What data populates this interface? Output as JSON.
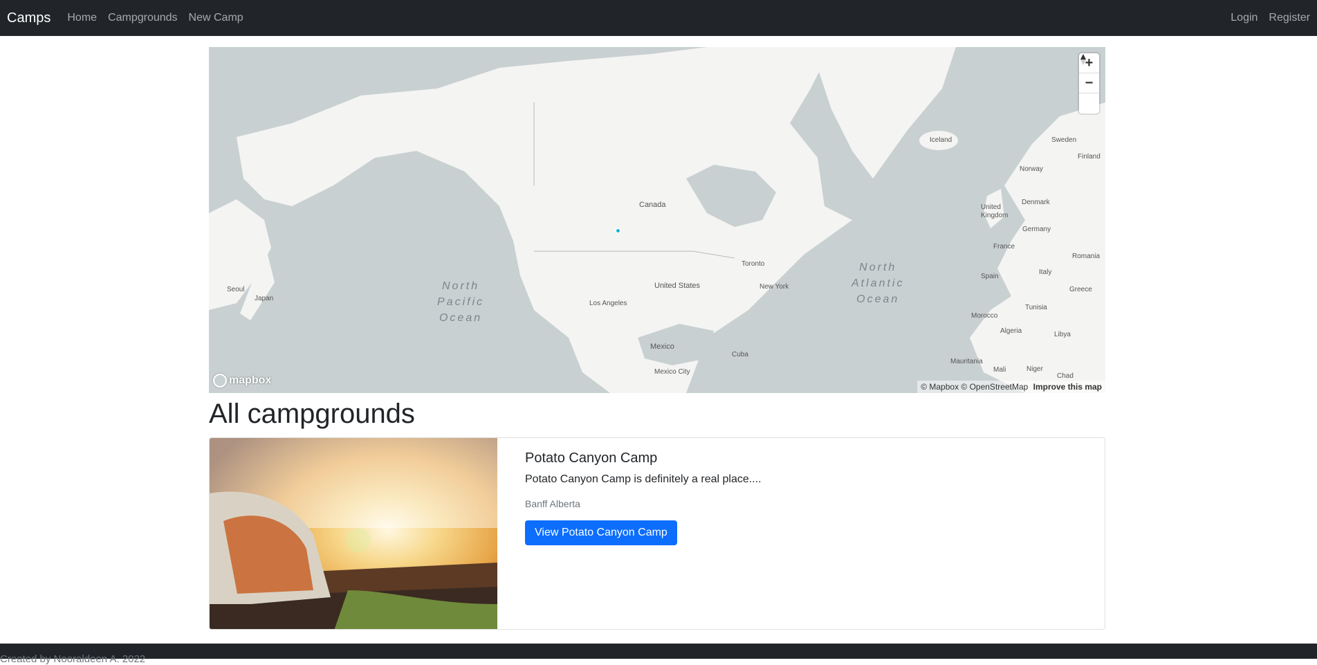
{
  "nav": {
    "brand": "Camps",
    "links": [
      "Home",
      "Campgrounds",
      "New Camp"
    ],
    "right": [
      "Login",
      "Register"
    ]
  },
  "map": {
    "labels": {
      "canada": "Canada",
      "united_states": "United States",
      "mexico": "Mexico",
      "mexico_city": "Mexico City",
      "cuba": "Cuba",
      "toronto": "Toronto",
      "new_york": "New York",
      "los_angeles": "Los Angeles",
      "north_pacific_ocean": "North\nPacific\nOcean",
      "north_atlantic_ocean": "North\nAtlantic\nOcean",
      "iceland": "Iceland",
      "sweden": "Sweden",
      "norway": "Norway",
      "finland": "Finland",
      "denmark": "Denmark",
      "united_kingdom": "United\nKingdom",
      "germany": "Germany",
      "france": "France",
      "spain": "Spain",
      "italy": "Italy",
      "romania": "Romania",
      "greece": "Greece",
      "tunisia": "Tunisia",
      "morocco": "Morocco",
      "algeria": "Algeria",
      "libya": "Libya",
      "mauritania": "Mauritania",
      "mali": "Mali",
      "niger": "Niger",
      "chad": "Chad",
      "seoul": "Seoul",
      "japan": "Japan"
    },
    "zoom_in": "+",
    "zoom_out": "−",
    "attribution": "© Mapbox © OpenStreetMap",
    "improve": "Improve this map",
    "logo": "mapbox",
    "accent": "#11b4da"
  },
  "heading": "All campgrounds",
  "campground": {
    "title": "Potato Canyon Camp",
    "description": "Potato Canyon Camp is definitely a real place....",
    "location": "Banff Alberta",
    "button": "View Potato Canyon Camp"
  },
  "footer": "Created by Nooraldeen A. 2022",
  "colors": {
    "navbar": "#212529",
    "primary": "#0d6efd",
    "water": "#c9d0d2",
    "land": "#f4f4f2"
  }
}
